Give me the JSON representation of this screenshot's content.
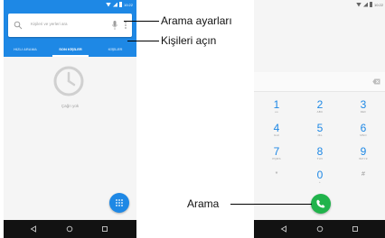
{
  "phone_left": {
    "status": {
      "time": "10:22"
    },
    "search": {
      "placeholder": "Kişileri ve yerleri ara"
    },
    "tabs": [
      {
        "label": "HIZLI ARAMA",
        "active": false
      },
      {
        "label": "SON KİŞİLER",
        "active": true
      },
      {
        "label": "KİŞİLER",
        "active": false
      }
    ],
    "recent": {
      "empty_text": "Çağrı yok"
    },
    "fab": {
      "icon": "dialpad-icon"
    },
    "nav": {
      "icons": [
        "back-icon",
        "home-icon",
        "recents-icon"
      ]
    }
  },
  "phone_right": {
    "status": {
      "time": "10:22"
    },
    "keypad": {
      "keys": [
        {
          "digit": "1",
          "letters": "oo"
        },
        {
          "digit": "2",
          "letters": "ABC"
        },
        {
          "digit": "3",
          "letters": "DEF"
        },
        {
          "digit": "4",
          "letters": "GHI"
        },
        {
          "digit": "5",
          "letters": "JKL"
        },
        {
          "digit": "6",
          "letters": "MNO"
        },
        {
          "digit": "7",
          "letters": "PQRS"
        },
        {
          "digit": "8",
          "letters": "TUV"
        },
        {
          "digit": "9",
          "letters": "WXYZ"
        },
        {
          "digit": "*",
          "letters": ""
        },
        {
          "digit": "0",
          "letters": "+"
        },
        {
          "digit": "#",
          "letters": ""
        }
      ]
    },
    "call_button": {
      "icon": "phone-call-icon"
    }
  },
  "callouts": {
    "search_settings": "Arama ayarları",
    "open_contacts": "Kişileri açın",
    "call": "Arama"
  },
  "colors": {
    "primary_blue": "#1e88e5",
    "call_green": "#20b34b",
    "navbar": "#121212"
  }
}
